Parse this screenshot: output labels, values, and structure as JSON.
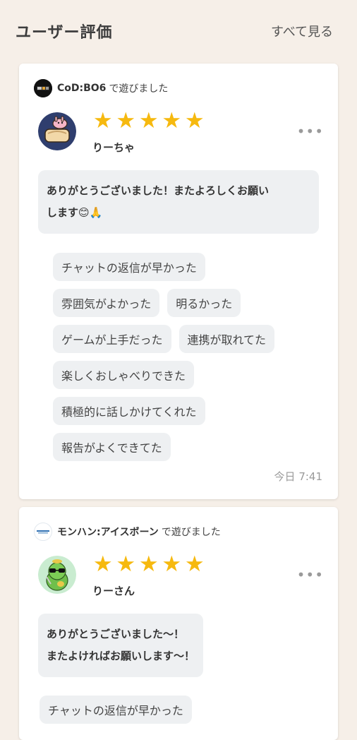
{
  "header": {
    "title": "ユーザー評価",
    "see_all": "すべて見る"
  },
  "reviews": [
    {
      "game_name": "CoD:BO6",
      "game_suffix": "で遊びました",
      "game_icon": "cod-bo6-game-icon",
      "user_name": "りーちゃ",
      "rating": 5,
      "stars": [
        "★",
        "★",
        "★",
        "★",
        "★"
      ],
      "more": "•••",
      "message_lines": [
        "ありがとうございました！またよろしくお願い",
        "します😊🙏"
      ],
      "tags": [
        [
          "チャットの返信が早かった"
        ],
        [
          "雰囲気がよかった",
          "明るかった"
        ],
        [
          "ゲームが上手だった",
          "連携が取れてた"
        ],
        [
          "楽しくおしゃべりできた"
        ],
        [
          "積極的に話しかけてくれた"
        ],
        [
          "報告がよくできてた"
        ]
      ],
      "timestamp": "今日 7:41"
    },
    {
      "game_name": "モンハン:アイスボーン",
      "game_suffix": "で遊びました",
      "game_icon": "monhun-iceborne-game-icon",
      "user_name": "りーさん",
      "rating": 5,
      "stars": [
        "★",
        "★",
        "★",
        "★",
        "★"
      ],
      "more": "•••",
      "message_lines": [
        "ありがとうございました〜！",
        "またよければお願いします〜！"
      ],
      "tags": [
        [
          "チャットの返信が早かった"
        ]
      ]
    }
  ],
  "colors": {
    "background": "#f6efe8",
    "star": "#f6b90f",
    "tag_bg": "#eef0f2"
  }
}
